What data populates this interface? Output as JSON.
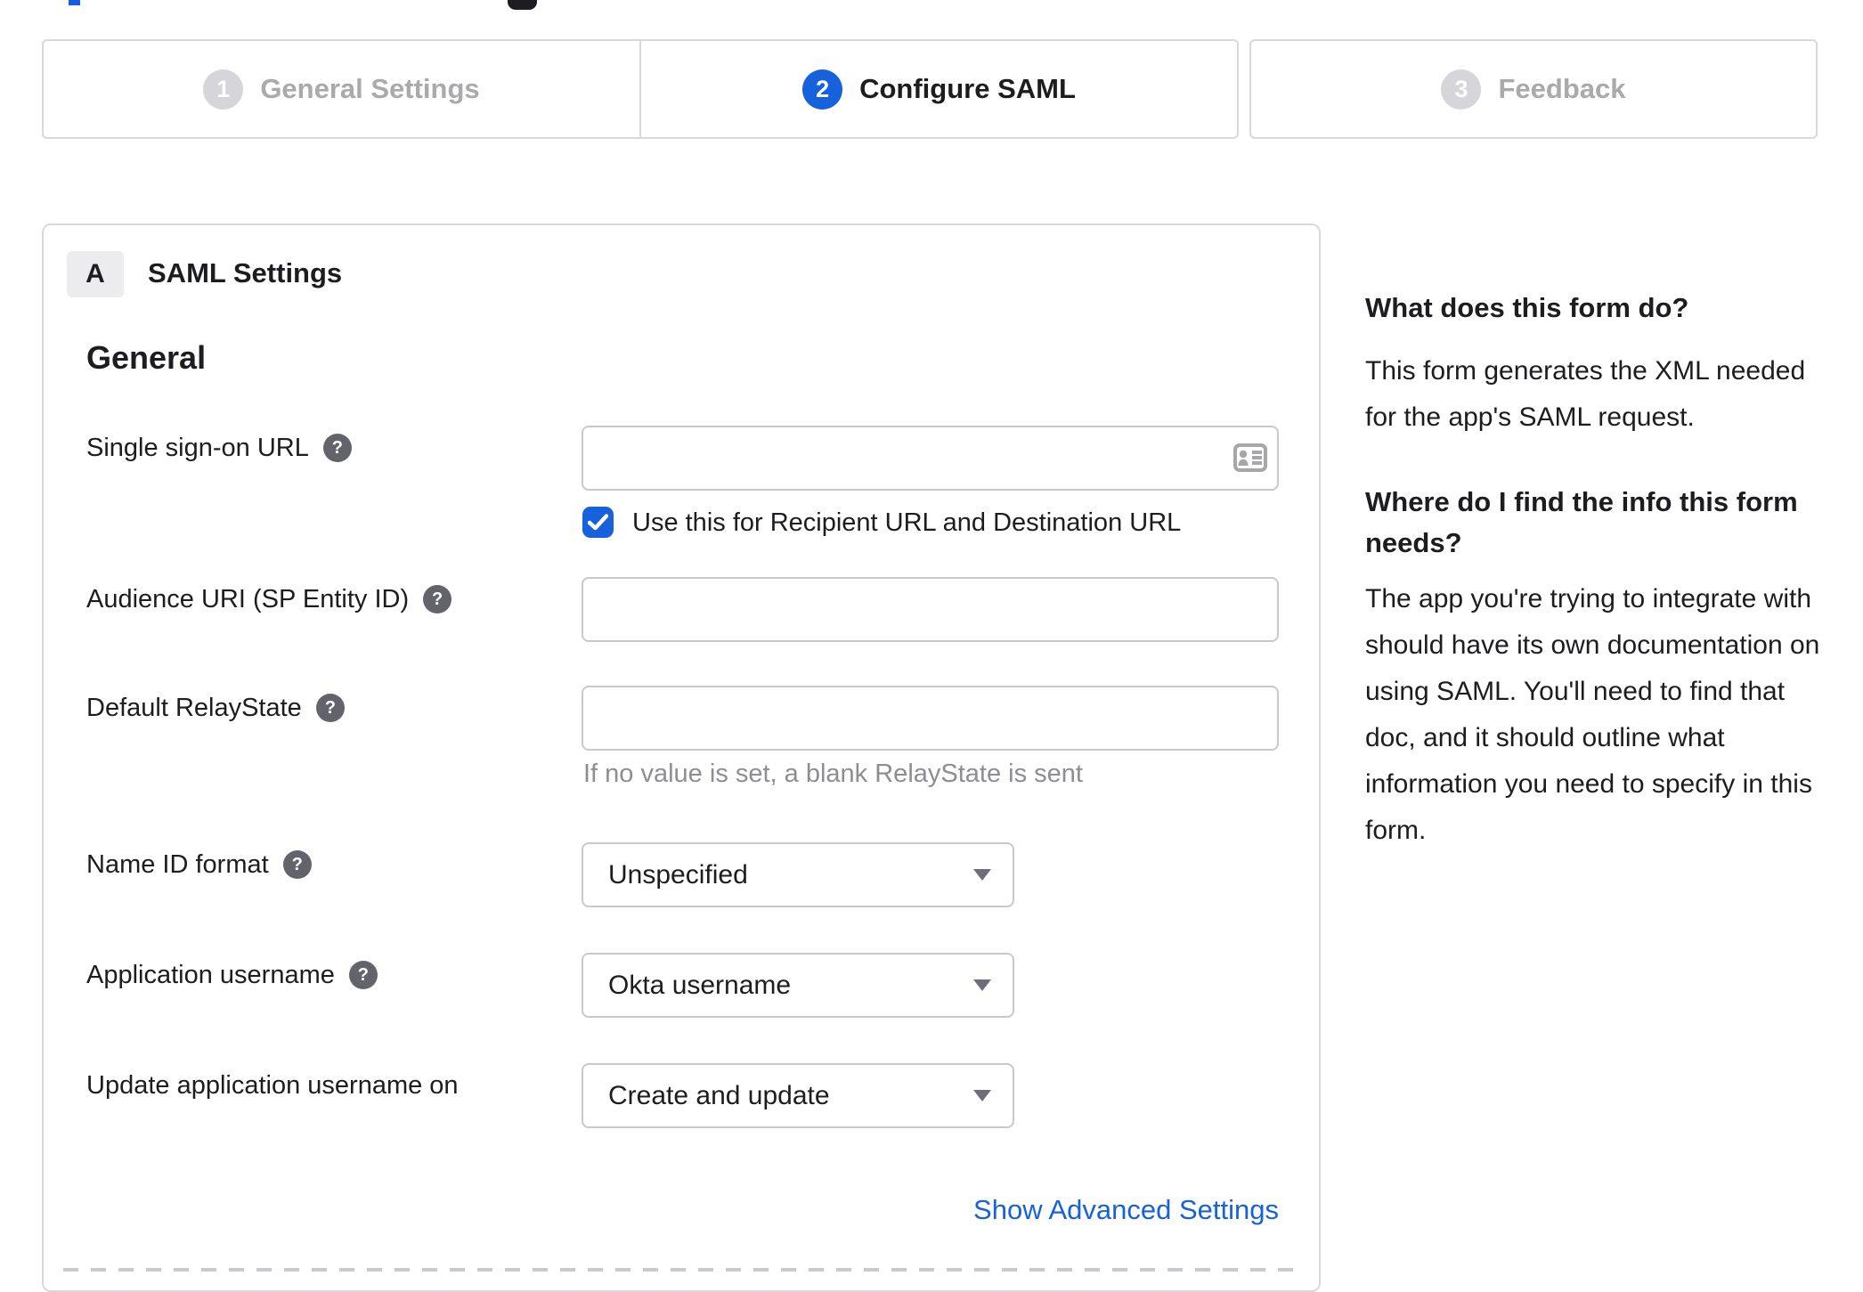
{
  "steps": [
    {
      "number": "1",
      "label": "General Settings",
      "state": "inactive"
    },
    {
      "number": "2",
      "label": "Configure SAML",
      "state": "active"
    },
    {
      "number": "3",
      "label": "Feedback",
      "state": "inactive"
    }
  ],
  "form": {
    "badge": "A",
    "title": "SAML Settings",
    "section_heading": "General",
    "fields": {
      "sso": {
        "label": "Single sign-on URL",
        "value": "",
        "checkbox_label": "Use this for Recipient URL and Destination URL",
        "checkbox_checked": true
      },
      "audience": {
        "label": "Audience URI (SP Entity ID)",
        "value": ""
      },
      "relay": {
        "label": "Default RelayState",
        "value": "",
        "hint": "If no value is set, a blank RelayState is sent"
      },
      "nameid": {
        "label": "Name ID format",
        "value": "Unspecified"
      },
      "appuser": {
        "label": "Application username",
        "value": "Okta username"
      },
      "update": {
        "label": "Update application username on",
        "value": "Create and update"
      }
    },
    "advanced_link": "Show Advanced Settings"
  },
  "help": {
    "q1": "What does this form do?",
    "a1_lines": [
      "This form generates the XML needed",
      "for the app's SAML request."
    ],
    "q2_lines": [
      "Where do I find the info this form",
      "needs?"
    ],
    "a2_lines": [
      "The app you're trying to integrate with",
      "should have its own documentation on",
      "using SAML. You'll need to find that",
      "doc, and it should outline what",
      "information you need to specify in this",
      "form."
    ]
  },
  "colors": {
    "accent_blue": "#1662dd",
    "inactive_circle_gray": "#d6d6da",
    "inactive_label_gray": "#a9a9ae",
    "panel_border": "#d9d9dd",
    "input_border": "#c8c8cd",
    "text_dark": "#1d1d21",
    "hint_gray": "#8d8d93",
    "help_icon_gray": "#63636b",
    "link_blue": "#1662dd"
  }
}
